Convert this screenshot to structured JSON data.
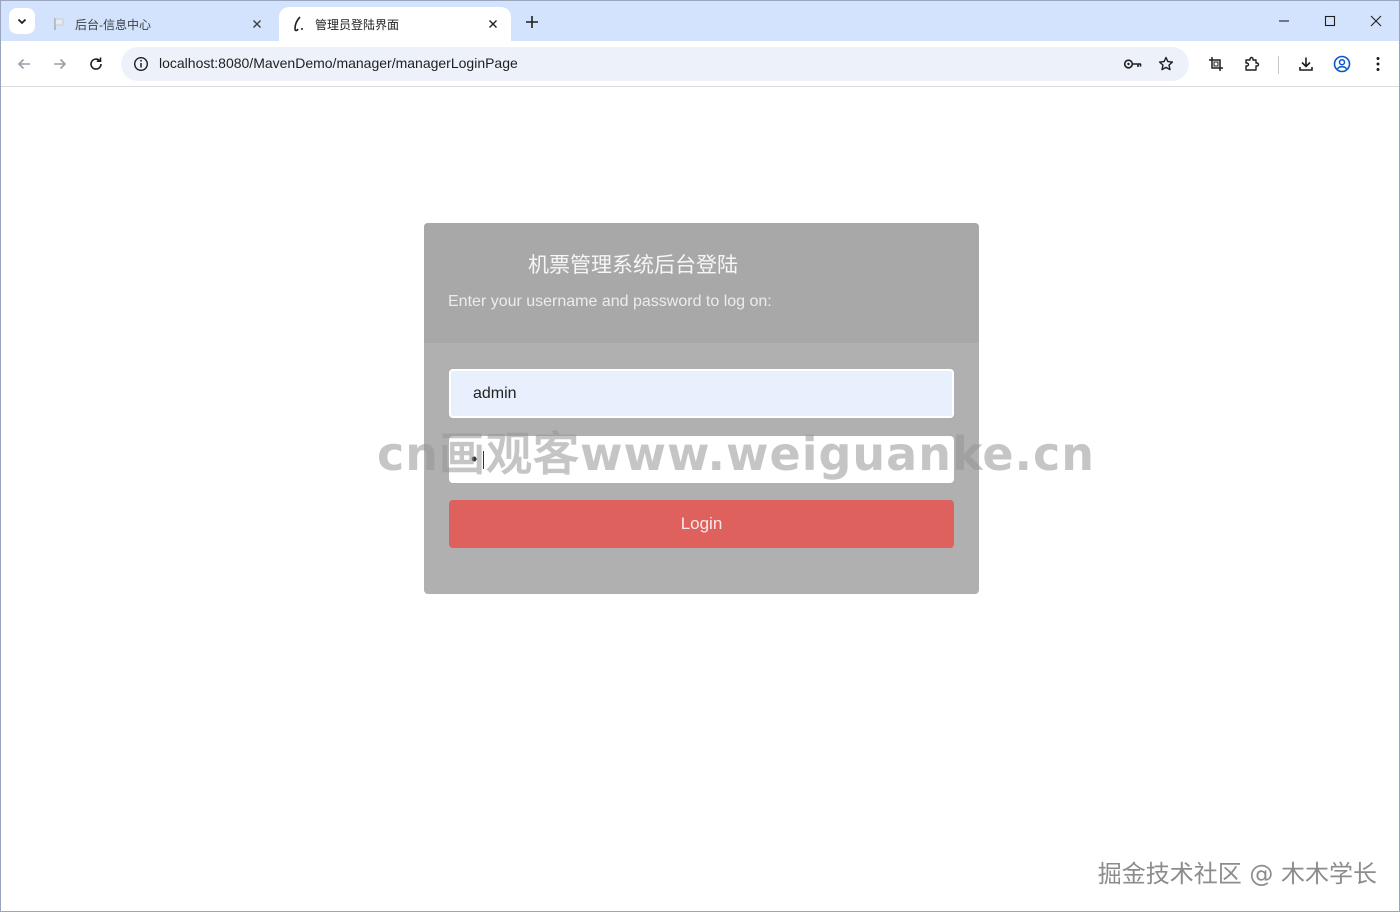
{
  "browser": {
    "tabs": [
      {
        "title": "后台-信息中心",
        "active": false
      },
      {
        "title": "管理员登陆界面",
        "active": true
      }
    ],
    "address": {
      "host": "localhost",
      "rest": ":8080/MavenDemo/manager/managerLoginPage"
    },
    "icons": {
      "tab_search": "chevron-down-icon",
      "new_tab": "plus-icon",
      "back": "arrow-left-icon",
      "forward": "arrow-right-icon",
      "reload": "reload-icon",
      "site_info": "info-icon",
      "password_key": "key-icon",
      "bookmark": "star-icon",
      "screenshot": "crop-icon",
      "extensions": "puzzle-icon",
      "downloads": "download-icon",
      "profile": "profile-icon",
      "menu": "more-vert-icon"
    }
  },
  "login": {
    "title": "机票管理系统后台登陆",
    "subtitle": "Enter your username and password to log on:",
    "username_value": "admin",
    "password_mask": "•",
    "button_label": "Login"
  },
  "watermarks": {
    "center": "cn画观客www.weiguanke.cn",
    "corner": "掘金技术社区 @ 木木学长"
  },
  "colors": {
    "tabstrip": "#d3e3fd",
    "omnibox": "#edf2fa",
    "login_header": "#a8a8a8",
    "login_body": "#b0b0b0",
    "login_button": "#de615e",
    "username_fill": "#e8f0fe"
  }
}
